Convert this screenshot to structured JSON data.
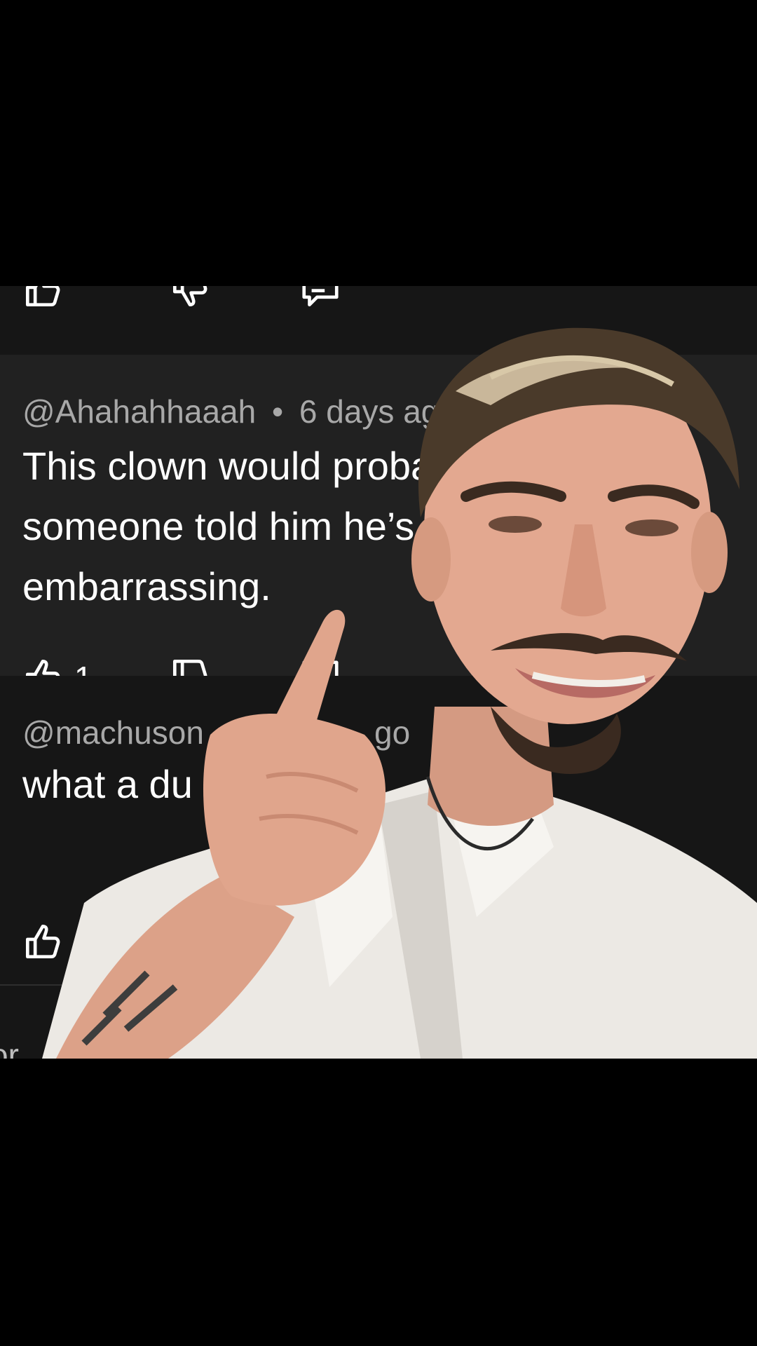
{
  "previous_comment": {
    "actions": {
      "like_icon": "thumbs-up-icon",
      "dislike_icon": "thumbs-down-icon",
      "reply_icon": "reply-icon"
    }
  },
  "comments": [
    {
      "username": "@Ahahahhaaah",
      "separator": "•",
      "time": "6 days ago",
      "text": "This clown would probably un alive if\nsomeone told him he’s\nembarrassing.",
      "like_count": "1",
      "icons": [
        "thumbs-up-icon",
        "thumbs-down-icon",
        "reply-icon"
      ]
    },
    {
      "username": "@machuson",
      "time_partial": "go",
      "text": "what a du",
      "icons": [
        "thumbs-up-icon"
      ]
    }
  ],
  "cut_off_text": "or",
  "colors": {
    "background": "#000000",
    "panel_active": "#212121",
    "panel": "#161616",
    "meta_text": "#a8a8a8",
    "body_text": "#ffffff"
  },
  "overlay": {
    "type": "person-cutout",
    "description_icon": "person-pointing-icon"
  }
}
